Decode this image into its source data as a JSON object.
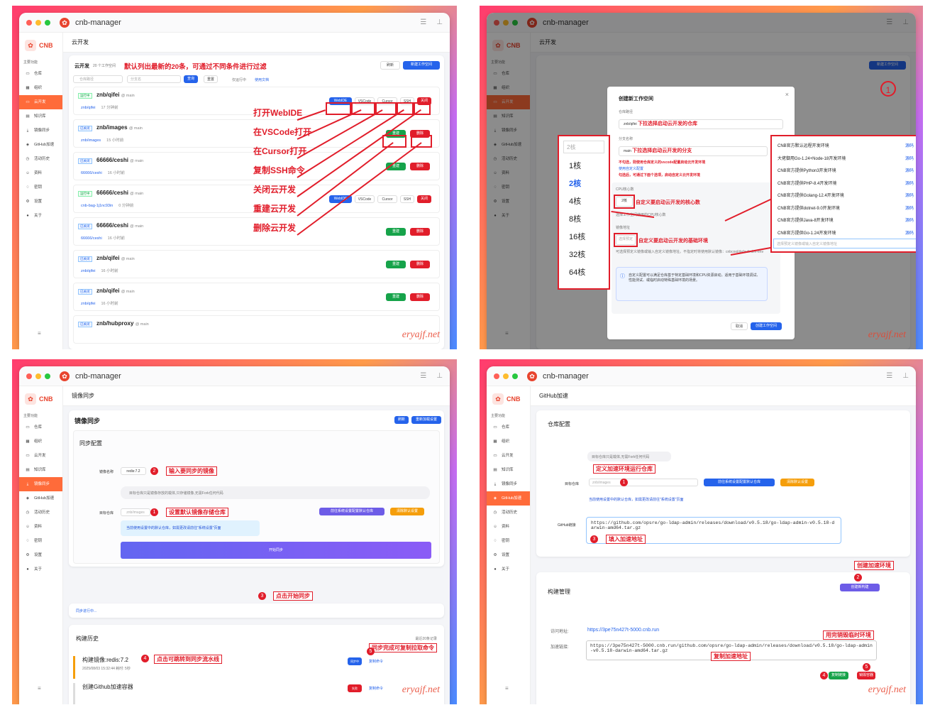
{
  "app_title": "cnb-manager",
  "brand": "CNB",
  "sidebar": {
    "section": "主要功能",
    "items": [
      "仓库",
      "组织",
      "云开发",
      "知识库",
      "镜像同步",
      "GitHub加速",
      "活动历史",
      "资料",
      "密钥",
      "设置",
      "关于"
    ]
  },
  "watermark": "eryajf.net",
  "q1": {
    "page_title": "云开发",
    "card_title": "云开发",
    "count": "20 个工作空间",
    "headline": "默认列出最新的20条，可通过不同条件进行过滤",
    "refresh": "刷新",
    "new_btn": "新建工作空间",
    "filter_repo": "仓库路径",
    "filter_branch": "分支名",
    "query": "查询",
    "reset": "重置",
    "only_running": "仅运行中",
    "docs": "使用文档",
    "rows": [
      {
        "status": "运行中",
        "name": "znb/qifei",
        "branch": "@ main",
        "sub": "znb/qifei",
        "time": "17 分钟前"
      },
      {
        "status": "已关闭",
        "name": "znb/images",
        "branch": "@ main",
        "sub": "znb/images",
        "time": "15 小时前"
      },
      {
        "status": "已关闭",
        "name": "66666/ceshi",
        "branch": "@ main",
        "sub": "66666/ceshi",
        "time": "16 小时前"
      },
      {
        "status": "运行中",
        "name": "66666/ceshi",
        "branch": "@ main",
        "sub": "cnb-bag-1j1nc93in",
        "time": "0 分钟前"
      },
      {
        "status": "已关闭",
        "name": "66666/ceshi",
        "branch": "@ main",
        "sub": "66666/ceshi",
        "time": "16 小时前"
      },
      {
        "status": "已关闭",
        "name": "znb/qifei",
        "branch": "@ main",
        "sub": "znb/qifei",
        "time": "16 小时前"
      },
      {
        "status": "已关闭",
        "name": "znb/qifei",
        "branch": "@ main",
        "sub": "znb/qifei",
        "time": "16 小时前"
      },
      {
        "status": "已关闭",
        "name": "znb/hubproxy",
        "branch": "@ main",
        "sub": "",
        "time": ""
      }
    ],
    "row_btns": {
      "webide": "WebIDE",
      "vscode": "VSCode",
      "cursor": "Cursor",
      "ssh": "SSH",
      "close": "关闭",
      "rebuild": "重建",
      "delete": "删除"
    },
    "annotations": [
      "打开WebIDE",
      "在VSCode打开",
      "在Cursor打开",
      "复制SSH命令",
      "关闭云开发",
      "重建云开发",
      "删除云开发"
    ]
  },
  "q2": {
    "page_title": "云开发",
    "modal_title": "创建新工作空间",
    "repo_label": "仓库路径",
    "repo_value": "znb/qifei",
    "repo_anno": "下拉选择启动云开发的仓库",
    "branch_label": "分支名称",
    "branch_value": "main",
    "branch_anno": "下拉选择启动云开发的分支",
    "vscode_note": "不勾选，则使用仓库定义的vscode配置启动云开发环境",
    "custom_label": "使用自定义配置",
    "custom_note": "勾选后，可通过下面个选项，启动自定义云开发环境",
    "cpu_label": "CPU核心数",
    "cpu_value": "2核",
    "cpu_anno": "自定义要启动云开发的核心数",
    "cpu_help": "选择工作空间使用的CPU核心数",
    "image_label": "镜像地址",
    "image_placeholder": "选择预定",
    "image_anno": "自定义要启动云开发的基础环境",
    "image_help": "可选择预定义镜像或输入自定义镜像地址。不指定时将使用默认镜像：cnbcool/default-dev-env",
    "info": "自定义配置可以满足仓库基于特定基础环境和CPU资源启动，适用于基础环境调试、性能测试、或临时启动特殊基础环境的场景。",
    "cancel": "取消",
    "create": "创建工作空间",
    "cores_placeholder": "2核",
    "cores": [
      "1核",
      "2核",
      "4核",
      "8核",
      "16核",
      "32核",
      "64核"
    ],
    "images": [
      "CNB官方默认远程开发环境",
      "大佬御用Go-1.24+Node-18开发环境",
      "CNB官方提供Python3开发环境",
      "CNB官方提供PHP-8.4开发环境",
      "CNB官方提供Golang-12.4开发环境",
      "CNB官方提供dotnet-9.0开发环境",
      "CNB官方提供Java-8开发环境",
      "CNB官方提供Go-1.24开发环境"
    ],
    "image_src": "源码",
    "image_input_placeholder": "选择预定义镜像或输入自定义镜像地址",
    "circle": "1"
  },
  "q3": {
    "page_title": "镜像同步",
    "card_title": "镜像同步",
    "refresh": "刷新",
    "reload": "重新加载设置",
    "config_title": "同步配置",
    "image_label": "镜像名称",
    "image_value": "redis:7.2",
    "image_anno": "输入要同步的镜像",
    "tip": "目标仓库只是镜像存放的载体,只存储镜像,无需Fork任何代码",
    "target_label": "目标仓库",
    "target_value": "znb/images",
    "target_anno": "设置默认镜像存储仓库",
    "goto_settings": "前往系统设置配置默认仓库",
    "clear_default": "清除默认设置",
    "default_tip": "当前使用设置中的默认仓库，如需更改请前往\"系统设置\"页面",
    "start": "开始同步",
    "start_anno": "点击开始同步",
    "syncing": "同步进行中...",
    "history_title": "构建历史",
    "recent": "最近20条记录",
    "copy_anno": "同步完成可复制拉取命令",
    "history": [
      {
        "title": "构建镜像:redis:7.2",
        "date": "2025/08/03 15:32:44",
        "elapsed": "耗时: 5秒",
        "status": "同步中",
        "copy": "复制命令"
      },
      {
        "title": "创建Github加速容器",
        "date": "",
        "elapsed": "",
        "status": "失败",
        "copy": "复制命令"
      }
    ],
    "history_anno": "点击可跳转到同步流水线",
    "nums": [
      "1",
      "2",
      "3",
      "4",
      "5"
    ]
  },
  "q4": {
    "page_title": "GitHub加速",
    "repo_title": "仓库配置",
    "tip": "目标仓库只是载体,无需Fork任何代码",
    "repo_anno": "定义加速环境运行仓库",
    "target_label": "目标仓库",
    "target_value": "znb/images",
    "goto_settings": "前往系统设置配置默认仓库",
    "clear_default": "清除默认设置",
    "default_tip": "当前使用设置中的默认仓库，如需更改请前往\"系统设置\"页面",
    "link_label": "GitHub链接",
    "link_value": "https://github.com/opsre/go-ldap-admin/releases/download/v0.5.18/go-ldap-admin-v0.5.18-darwin-amd64.tar.gz",
    "link_anno": "填入加速地址",
    "create_anno": "创建加速环境",
    "build_title": "构建管理",
    "create_btn": "创建新构建",
    "visit_label": "访问地址:",
    "visit_value": "https://3pe75n427t-5000.cnb.run",
    "accel_label": "加速链接:",
    "accel_value": "https://3pe75n427t-5000.cnb.run/github.com/opsre/go-ldap-admin/releases/download/v0.5.18/go-ldap-admin-v0.5.18-darwin-amd64.tar.gz",
    "destroy_anno": "用完销毁临时环境",
    "copy_anno": "复制加速地址",
    "copy_btn": "复制链接",
    "destroy_btn": "销毁容器",
    "nums": [
      "1",
      "2",
      "3",
      "4",
      "5"
    ]
  }
}
